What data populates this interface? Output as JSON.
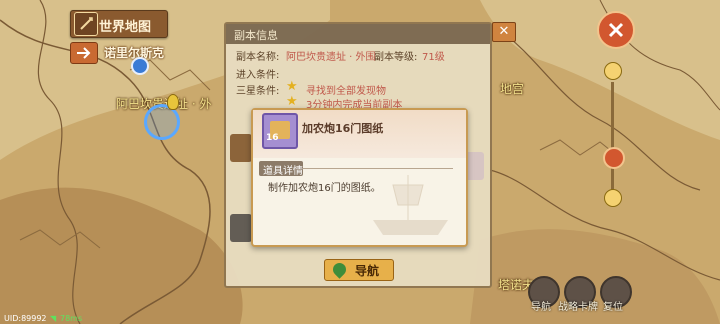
{
  "header": {
    "title": "世界地图",
    "location": "诺里尔斯克"
  },
  "map_labels": {
    "site": "阿巴坎贵遗址 · 外",
    "palace": "地宫",
    "bottom": "塔诺夫"
  },
  "dialog": {
    "title": "副本信息",
    "name_label": "副本名称:",
    "name_value": "阿巴坎贵遗址 · 外围",
    "level_label": "副本等级:",
    "level_value": "71级",
    "entry_label": "进入条件:",
    "star_label": "三星条件:",
    "star_conditions": [
      "寻找到全部发现物",
      "3分钟内完成当前副本"
    ],
    "nav_button": "导航"
  },
  "tooltip": {
    "item_name": "加农炮16门图纸",
    "item_count": "16",
    "section": "道具详情",
    "description": "制作加农炮16门的图纸。"
  },
  "bottom_buttons": {
    "navigate": "导航",
    "tactics": "战略卡牌",
    "reset": "复位"
  },
  "status": {
    "uid": "UID:89992",
    "signal": "78ms"
  },
  "colors": {
    "accent": "#e7b04a",
    "panel": "#e8dcc0",
    "header": "#7c6a52"
  }
}
